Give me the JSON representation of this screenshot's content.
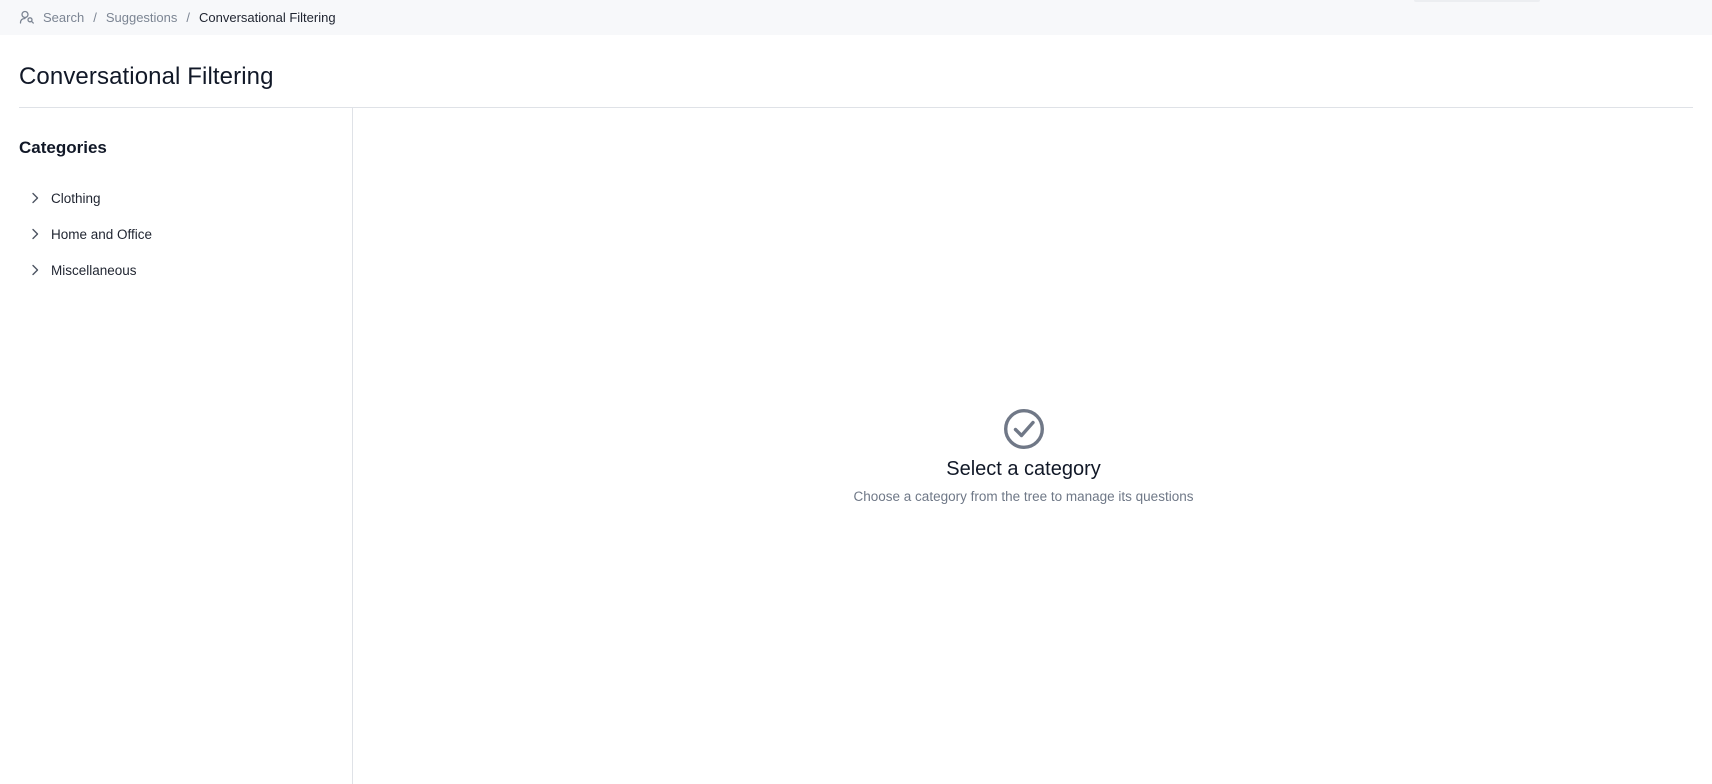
{
  "breadcrumb": {
    "icon": "search-users-icon",
    "items": [
      "Search",
      "Suggestions"
    ],
    "separator": "/",
    "current": "Conversational Filtering"
  },
  "page": {
    "title": "Conversational Filtering"
  },
  "sidebar": {
    "heading": "Categories",
    "items": [
      {
        "label": "Clothing",
        "icon": "chevron-right-icon"
      },
      {
        "label": "Home and Office",
        "icon": "chevron-right-icon"
      },
      {
        "label": "Miscellaneous",
        "icon": "chevron-right-icon"
      }
    ]
  },
  "empty_state": {
    "icon": "check-circle-icon",
    "title": "Select a category",
    "subtitle": "Choose a category from the tree to manage its questions"
  },
  "colors": {
    "topbar_bg": "#f7f8fa",
    "divider": "#dfe2e7",
    "muted_text": "#7c8593",
    "icon_gray": "#707887"
  }
}
